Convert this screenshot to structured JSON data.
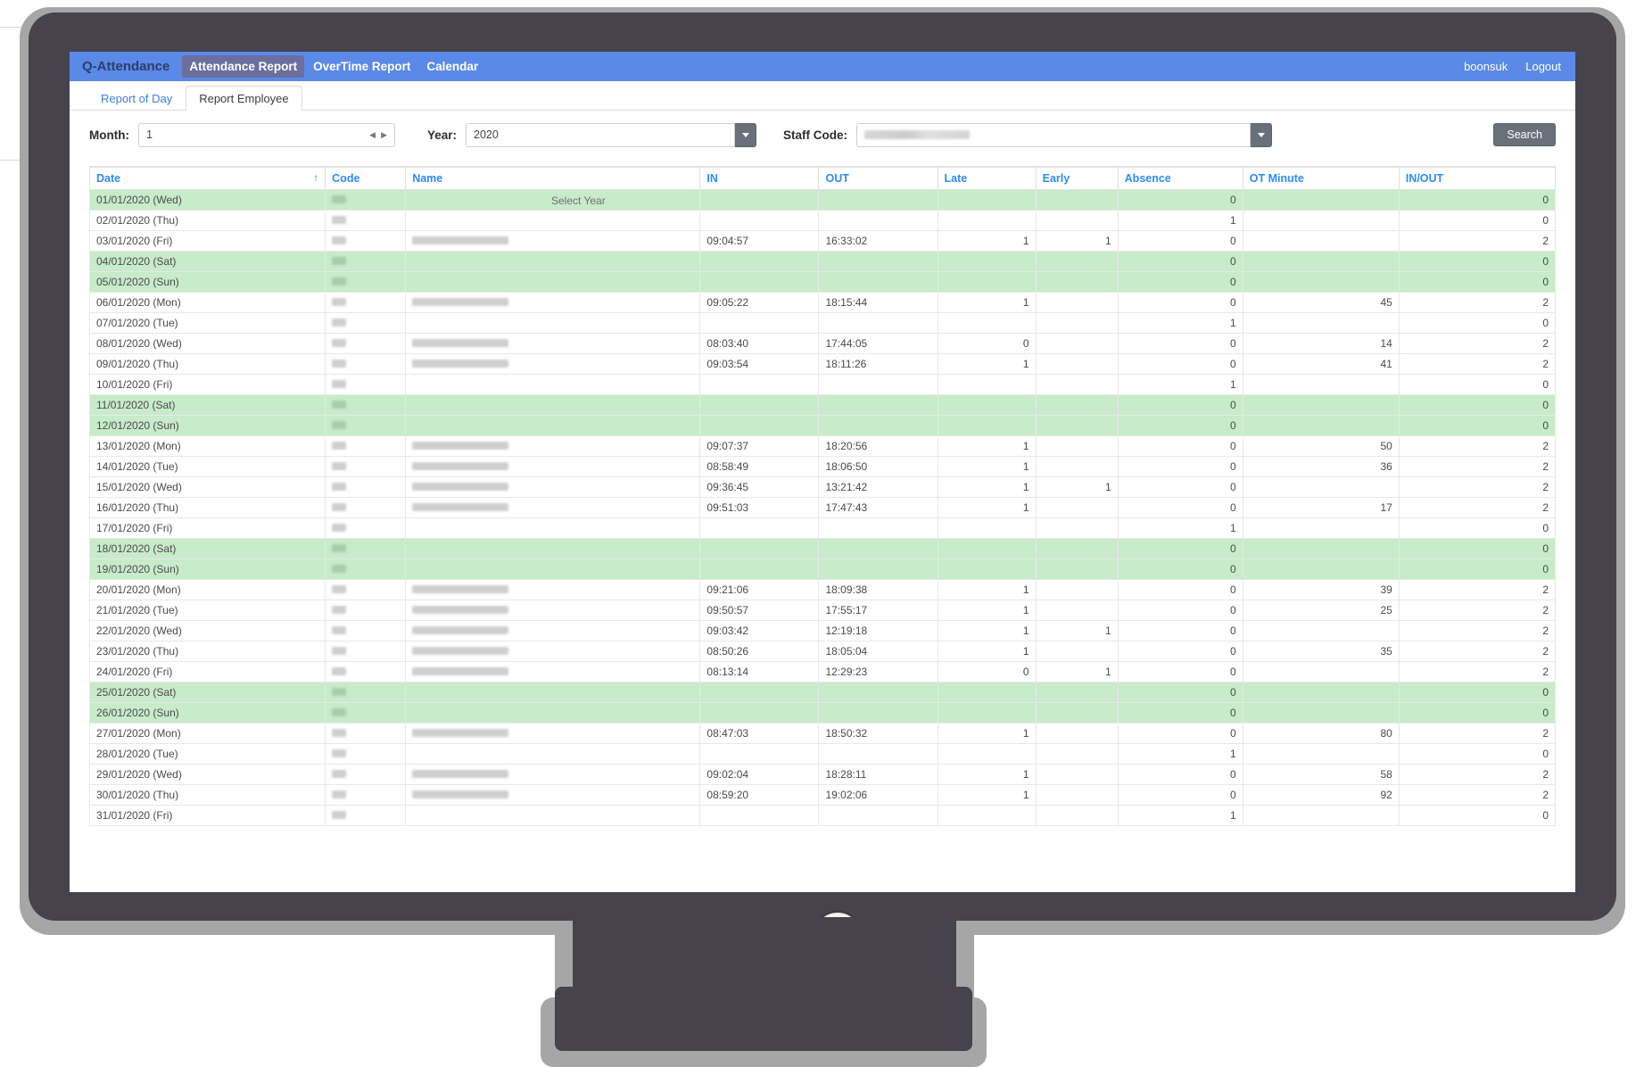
{
  "navbar": {
    "brand": "Q-Attendance",
    "links": [
      {
        "label": "Attendance Report",
        "active": true
      },
      {
        "label": "OverTime Report",
        "active": false
      },
      {
        "label": "Calendar",
        "active": false
      }
    ],
    "user": "boonsuk",
    "logout": "Logout",
    "background_color": "#5b89e8",
    "active_color": "#6c6f9e"
  },
  "tabs": [
    {
      "label": "Report of Day",
      "active": false
    },
    {
      "label": "Report Employee",
      "active": true
    }
  ],
  "filters": {
    "month_label": "Month:",
    "month_value": "1",
    "year_label": "Year:",
    "year_value": "2020",
    "year_hint": "Select Year",
    "staff_label": "Staff Code:",
    "staff_value": "",
    "search_label": "Search"
  },
  "table": {
    "columns": [
      "Date",
      "Code",
      "Name",
      "IN",
      "OUT",
      "Late",
      "Early",
      "Absence",
      "OT Minute",
      "IN/OUT"
    ],
    "sort_column": "Date",
    "sort_direction": "asc",
    "rows": [
      {
        "date": "01/01/2020 (Wed)",
        "code": "",
        "name": "",
        "in": "",
        "out": "",
        "late": "",
        "early": "",
        "absence": "0",
        "ot": "",
        "inout": "0",
        "weekend": true
      },
      {
        "date": "02/01/2020 (Thu)",
        "code": "",
        "name": "",
        "in": "",
        "out": "",
        "late": "",
        "early": "",
        "absence": "1",
        "ot": "",
        "inout": "0",
        "weekend": false
      },
      {
        "date": "03/01/2020 (Fri)",
        "code": "",
        "name": "",
        "in": "09:04:57",
        "out": "16:33:02",
        "late": "1",
        "early": "1",
        "absence": "0",
        "ot": "",
        "inout": "2",
        "weekend": false
      },
      {
        "date": "04/01/2020 (Sat)",
        "code": "",
        "name": "",
        "in": "",
        "out": "",
        "late": "",
        "early": "",
        "absence": "0",
        "ot": "",
        "inout": "0",
        "weekend": true
      },
      {
        "date": "05/01/2020 (Sun)",
        "code": "",
        "name": "",
        "in": "",
        "out": "",
        "late": "",
        "early": "",
        "absence": "0",
        "ot": "",
        "inout": "0",
        "weekend": true
      },
      {
        "date": "06/01/2020 (Mon)",
        "code": "",
        "name": "",
        "in": "09:05:22",
        "out": "18:15:44",
        "late": "1",
        "early": "",
        "absence": "0",
        "ot": "45",
        "inout": "2",
        "weekend": false
      },
      {
        "date": "07/01/2020 (Tue)",
        "code": "",
        "name": "",
        "in": "",
        "out": "",
        "late": "",
        "early": "",
        "absence": "1",
        "ot": "",
        "inout": "0",
        "weekend": false
      },
      {
        "date": "08/01/2020 (Wed)",
        "code": "",
        "name": "",
        "in": "08:03:40",
        "out": "17:44:05",
        "late": "0",
        "early": "",
        "absence": "0",
        "ot": "14",
        "inout": "2",
        "weekend": false
      },
      {
        "date": "09/01/2020 (Thu)",
        "code": "",
        "name": "",
        "in": "09:03:54",
        "out": "18:11:26",
        "late": "1",
        "early": "",
        "absence": "0",
        "ot": "41",
        "inout": "2",
        "weekend": false
      },
      {
        "date": "10/01/2020 (Fri)",
        "code": "",
        "name": "",
        "in": "",
        "out": "",
        "late": "",
        "early": "",
        "absence": "1",
        "ot": "",
        "inout": "0",
        "weekend": false
      },
      {
        "date": "11/01/2020 (Sat)",
        "code": "",
        "name": "",
        "in": "",
        "out": "",
        "late": "",
        "early": "",
        "absence": "0",
        "ot": "",
        "inout": "0",
        "weekend": true
      },
      {
        "date": "12/01/2020 (Sun)",
        "code": "",
        "name": "",
        "in": "",
        "out": "",
        "late": "",
        "early": "",
        "absence": "0",
        "ot": "",
        "inout": "0",
        "weekend": true
      },
      {
        "date": "13/01/2020 (Mon)",
        "code": "",
        "name": "",
        "in": "09:07:37",
        "out": "18:20:56",
        "late": "1",
        "early": "",
        "absence": "0",
        "ot": "50",
        "inout": "2",
        "weekend": false
      },
      {
        "date": "14/01/2020 (Tue)",
        "code": "",
        "name": "",
        "in": "08:58:49",
        "out": "18:06:50",
        "late": "1",
        "early": "",
        "absence": "0",
        "ot": "36",
        "inout": "2",
        "weekend": false
      },
      {
        "date": "15/01/2020 (Wed)",
        "code": "",
        "name": "",
        "in": "09:36:45",
        "out": "13:21:42",
        "late": "1",
        "early": "1",
        "absence": "0",
        "ot": "",
        "inout": "2",
        "weekend": false
      },
      {
        "date": "16/01/2020 (Thu)",
        "code": "",
        "name": "",
        "in": "09:51:03",
        "out": "17:47:43",
        "late": "1",
        "early": "",
        "absence": "0",
        "ot": "17",
        "inout": "2",
        "weekend": false
      },
      {
        "date": "17/01/2020 (Fri)",
        "code": "",
        "name": "",
        "in": "",
        "out": "",
        "late": "",
        "early": "",
        "absence": "1",
        "ot": "",
        "inout": "0",
        "weekend": false
      },
      {
        "date": "18/01/2020 (Sat)",
        "code": "",
        "name": "",
        "in": "",
        "out": "",
        "late": "",
        "early": "",
        "absence": "0",
        "ot": "",
        "inout": "0",
        "weekend": true
      },
      {
        "date": "19/01/2020 (Sun)",
        "code": "",
        "name": "",
        "in": "",
        "out": "",
        "late": "",
        "early": "",
        "absence": "0",
        "ot": "",
        "inout": "0",
        "weekend": true
      },
      {
        "date": "20/01/2020 (Mon)",
        "code": "",
        "name": "",
        "in": "09:21:06",
        "out": "18:09:38",
        "late": "1",
        "early": "",
        "absence": "0",
        "ot": "39",
        "inout": "2",
        "weekend": false
      },
      {
        "date": "21/01/2020 (Tue)",
        "code": "",
        "name": "",
        "in": "09:50:57",
        "out": "17:55:17",
        "late": "1",
        "early": "",
        "absence": "0",
        "ot": "25",
        "inout": "2",
        "weekend": false
      },
      {
        "date": "22/01/2020 (Wed)",
        "code": "",
        "name": "",
        "in": "09:03:42",
        "out": "12:19:18",
        "late": "1",
        "early": "1",
        "absence": "0",
        "ot": "",
        "inout": "2",
        "weekend": false
      },
      {
        "date": "23/01/2020 (Thu)",
        "code": "",
        "name": "",
        "in": "08:50:26",
        "out": "18:05:04",
        "late": "1",
        "early": "",
        "absence": "0",
        "ot": "35",
        "inout": "2",
        "weekend": false
      },
      {
        "date": "24/01/2020 (Fri)",
        "code": "",
        "name": "",
        "in": "08:13:14",
        "out": "12:29:23",
        "late": "0",
        "early": "1",
        "absence": "0",
        "ot": "",
        "inout": "2",
        "weekend": false
      },
      {
        "date": "25/01/2020 (Sat)",
        "code": "",
        "name": "",
        "in": "",
        "out": "",
        "late": "",
        "early": "",
        "absence": "0",
        "ot": "",
        "inout": "0",
        "weekend": true
      },
      {
        "date": "26/01/2020 (Sun)",
        "code": "",
        "name": "",
        "in": "",
        "out": "",
        "late": "",
        "early": "",
        "absence": "0",
        "ot": "",
        "inout": "0",
        "weekend": true
      },
      {
        "date": "27/01/2020 (Mon)",
        "code": "",
        "name": "",
        "in": "08:47:03",
        "out": "18:50:32",
        "late": "1",
        "early": "",
        "absence": "0",
        "ot": "80",
        "inout": "2",
        "weekend": false
      },
      {
        "date": "28/01/2020 (Tue)",
        "code": "",
        "name": "",
        "in": "",
        "out": "",
        "late": "",
        "early": "",
        "absence": "1",
        "ot": "",
        "inout": "0",
        "weekend": false
      },
      {
        "date": "29/01/2020 (Wed)",
        "code": "",
        "name": "",
        "in": "09:02:04",
        "out": "18:28:11",
        "late": "1",
        "early": "",
        "absence": "0",
        "ot": "58",
        "inout": "2",
        "weekend": false
      },
      {
        "date": "30/01/2020 (Thu)",
        "code": "",
        "name": "",
        "in": "08:59:20",
        "out": "19:02:06",
        "late": "1",
        "early": "",
        "absence": "0",
        "ot": "92",
        "inout": "2",
        "weekend": false
      },
      {
        "date": "31/01/2020 (Fri)",
        "code": "",
        "name": "",
        "in": "",
        "out": "",
        "late": "",
        "early": "",
        "absence": "1",
        "ot": "",
        "inout": "0",
        "weekend": false
      }
    ]
  },
  "colors": {
    "weekend_row": "#c8ebca",
    "header_text": "#2f8bf7",
    "link_blue": "#4c8df6",
    "navbar": "#5b89e8",
    "monitor_bezel": "#46434c",
    "monitor_edge": "#a6a6a6"
  }
}
